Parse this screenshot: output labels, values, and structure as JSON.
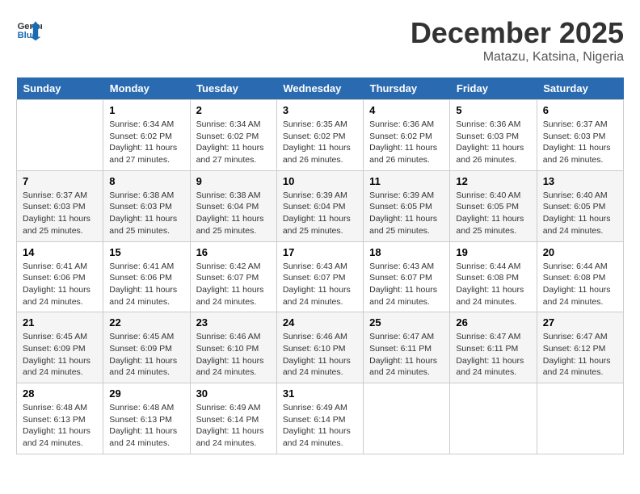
{
  "header": {
    "logo_line1": "General",
    "logo_line2": "Blue",
    "month": "December 2025",
    "location": "Matazu, Katsina, Nigeria"
  },
  "weekdays": [
    "Sunday",
    "Monday",
    "Tuesday",
    "Wednesday",
    "Thursday",
    "Friday",
    "Saturday"
  ],
  "weeks": [
    [
      {
        "day": "",
        "sunrise": "",
        "sunset": "",
        "daylight": ""
      },
      {
        "day": "1",
        "sunrise": "Sunrise: 6:34 AM",
        "sunset": "Sunset: 6:02 PM",
        "daylight": "Daylight: 11 hours and 27 minutes."
      },
      {
        "day": "2",
        "sunrise": "Sunrise: 6:34 AM",
        "sunset": "Sunset: 6:02 PM",
        "daylight": "Daylight: 11 hours and 27 minutes."
      },
      {
        "day": "3",
        "sunrise": "Sunrise: 6:35 AM",
        "sunset": "Sunset: 6:02 PM",
        "daylight": "Daylight: 11 hours and 26 minutes."
      },
      {
        "day": "4",
        "sunrise": "Sunrise: 6:36 AM",
        "sunset": "Sunset: 6:02 PM",
        "daylight": "Daylight: 11 hours and 26 minutes."
      },
      {
        "day": "5",
        "sunrise": "Sunrise: 6:36 AM",
        "sunset": "Sunset: 6:03 PM",
        "daylight": "Daylight: 11 hours and 26 minutes."
      },
      {
        "day": "6",
        "sunrise": "Sunrise: 6:37 AM",
        "sunset": "Sunset: 6:03 PM",
        "daylight": "Daylight: 11 hours and 26 minutes."
      }
    ],
    [
      {
        "day": "7",
        "sunrise": "Sunrise: 6:37 AM",
        "sunset": "Sunset: 6:03 PM",
        "daylight": "Daylight: 11 hours and 25 minutes."
      },
      {
        "day": "8",
        "sunrise": "Sunrise: 6:38 AM",
        "sunset": "Sunset: 6:03 PM",
        "daylight": "Daylight: 11 hours and 25 minutes."
      },
      {
        "day": "9",
        "sunrise": "Sunrise: 6:38 AM",
        "sunset": "Sunset: 6:04 PM",
        "daylight": "Daylight: 11 hours and 25 minutes."
      },
      {
        "day": "10",
        "sunrise": "Sunrise: 6:39 AM",
        "sunset": "Sunset: 6:04 PM",
        "daylight": "Daylight: 11 hours and 25 minutes."
      },
      {
        "day": "11",
        "sunrise": "Sunrise: 6:39 AM",
        "sunset": "Sunset: 6:05 PM",
        "daylight": "Daylight: 11 hours and 25 minutes."
      },
      {
        "day": "12",
        "sunrise": "Sunrise: 6:40 AM",
        "sunset": "Sunset: 6:05 PM",
        "daylight": "Daylight: 11 hours and 25 minutes."
      },
      {
        "day": "13",
        "sunrise": "Sunrise: 6:40 AM",
        "sunset": "Sunset: 6:05 PM",
        "daylight": "Daylight: 11 hours and 24 minutes."
      }
    ],
    [
      {
        "day": "14",
        "sunrise": "Sunrise: 6:41 AM",
        "sunset": "Sunset: 6:06 PM",
        "daylight": "Daylight: 11 hours and 24 minutes."
      },
      {
        "day": "15",
        "sunrise": "Sunrise: 6:41 AM",
        "sunset": "Sunset: 6:06 PM",
        "daylight": "Daylight: 11 hours and 24 minutes."
      },
      {
        "day": "16",
        "sunrise": "Sunrise: 6:42 AM",
        "sunset": "Sunset: 6:07 PM",
        "daylight": "Daylight: 11 hours and 24 minutes."
      },
      {
        "day": "17",
        "sunrise": "Sunrise: 6:43 AM",
        "sunset": "Sunset: 6:07 PM",
        "daylight": "Daylight: 11 hours and 24 minutes."
      },
      {
        "day": "18",
        "sunrise": "Sunrise: 6:43 AM",
        "sunset": "Sunset: 6:07 PM",
        "daylight": "Daylight: 11 hours and 24 minutes."
      },
      {
        "day": "19",
        "sunrise": "Sunrise: 6:44 AM",
        "sunset": "Sunset: 6:08 PM",
        "daylight": "Daylight: 11 hours and 24 minutes."
      },
      {
        "day": "20",
        "sunrise": "Sunrise: 6:44 AM",
        "sunset": "Sunset: 6:08 PM",
        "daylight": "Daylight: 11 hours and 24 minutes."
      }
    ],
    [
      {
        "day": "21",
        "sunrise": "Sunrise: 6:45 AM",
        "sunset": "Sunset: 6:09 PM",
        "daylight": "Daylight: 11 hours and 24 minutes."
      },
      {
        "day": "22",
        "sunrise": "Sunrise: 6:45 AM",
        "sunset": "Sunset: 6:09 PM",
        "daylight": "Daylight: 11 hours and 24 minutes."
      },
      {
        "day": "23",
        "sunrise": "Sunrise: 6:46 AM",
        "sunset": "Sunset: 6:10 PM",
        "daylight": "Daylight: 11 hours and 24 minutes."
      },
      {
        "day": "24",
        "sunrise": "Sunrise: 6:46 AM",
        "sunset": "Sunset: 6:10 PM",
        "daylight": "Daylight: 11 hours and 24 minutes."
      },
      {
        "day": "25",
        "sunrise": "Sunrise: 6:47 AM",
        "sunset": "Sunset: 6:11 PM",
        "daylight": "Daylight: 11 hours and 24 minutes."
      },
      {
        "day": "26",
        "sunrise": "Sunrise: 6:47 AM",
        "sunset": "Sunset: 6:11 PM",
        "daylight": "Daylight: 11 hours and 24 minutes."
      },
      {
        "day": "27",
        "sunrise": "Sunrise: 6:47 AM",
        "sunset": "Sunset: 6:12 PM",
        "daylight": "Daylight: 11 hours and 24 minutes."
      }
    ],
    [
      {
        "day": "28",
        "sunrise": "Sunrise: 6:48 AM",
        "sunset": "Sunset: 6:13 PM",
        "daylight": "Daylight: 11 hours and 24 minutes."
      },
      {
        "day": "29",
        "sunrise": "Sunrise: 6:48 AM",
        "sunset": "Sunset: 6:13 PM",
        "daylight": "Daylight: 11 hours and 24 minutes."
      },
      {
        "day": "30",
        "sunrise": "Sunrise: 6:49 AM",
        "sunset": "Sunset: 6:14 PM",
        "daylight": "Daylight: 11 hours and 24 minutes."
      },
      {
        "day": "31",
        "sunrise": "Sunrise: 6:49 AM",
        "sunset": "Sunset: 6:14 PM",
        "daylight": "Daylight: 11 hours and 24 minutes."
      },
      {
        "day": "",
        "sunrise": "",
        "sunset": "",
        "daylight": ""
      },
      {
        "day": "",
        "sunrise": "",
        "sunset": "",
        "daylight": ""
      },
      {
        "day": "",
        "sunrise": "",
        "sunset": "",
        "daylight": ""
      }
    ]
  ]
}
